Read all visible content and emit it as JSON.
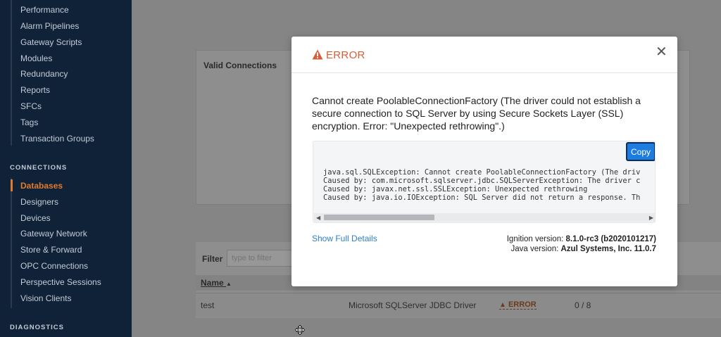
{
  "sidebar": {
    "top_items": [
      {
        "label": "Performance"
      },
      {
        "label": "Alarm Pipelines"
      },
      {
        "label": "Gateway Scripts"
      },
      {
        "label": "Modules"
      },
      {
        "label": "Redundancy"
      },
      {
        "label": "Reports"
      },
      {
        "label": "SFCs"
      },
      {
        "label": "Tags"
      },
      {
        "label": "Transaction Groups"
      }
    ],
    "connections_heading": "CONNECTIONS",
    "connection_items": [
      {
        "label": "Databases",
        "active": true
      },
      {
        "label": "Designers"
      },
      {
        "label": "Devices"
      },
      {
        "label": "Gateway Network"
      },
      {
        "label": "Store & Forward"
      },
      {
        "label": "OPC Connections"
      },
      {
        "label": "Perspective Sessions"
      },
      {
        "label": "Vision Clients"
      }
    ],
    "diagnostics_heading": "DIAGNOSTICS"
  },
  "main": {
    "valid_connections_title": "Valid Connections",
    "filter_label": "Filter",
    "filter_placeholder": "type to filter",
    "column_name": "Name",
    "row": {
      "name": "test",
      "driver": "Microsoft SQLServer JDBC Driver",
      "status": "ERROR",
      "count": "0 / 8"
    }
  },
  "modal": {
    "title": "ERROR",
    "message": "Cannot create PoolableConnectionFactory (The driver could not establish a secure connection to SQL Server by using Secure Sockets Layer (SSL) encryption. Error: \"Unexpected rethrowing\".)",
    "copy_label": "Copy",
    "trace": "java.sql.SQLException: Cannot create PoolableConnectionFactory (The driv\nCaused by: com.microsoft.sqlserver.jdbc.SQLServerException: The driver c\nCaused by: javax.net.ssl.SSLException: Unexpected rethrowing\nCaused by: java.io.IOException: SQL Server did not return a response. Th",
    "show_details": "Show Full Details",
    "ignition_label": "Ignition version: ",
    "ignition_value": "8.1.0-rc3 (b2020101217)",
    "java_label": "Java version: ",
    "java_value": "Azul Systems, Inc. 11.0.7"
  },
  "colors": {
    "sidebar_bg": "#0f2238",
    "accent_orange": "#e07a2c",
    "error_red": "#d75d3a",
    "copy_blue": "#1d7ce0",
    "link_blue": "#2d7fc9"
  }
}
